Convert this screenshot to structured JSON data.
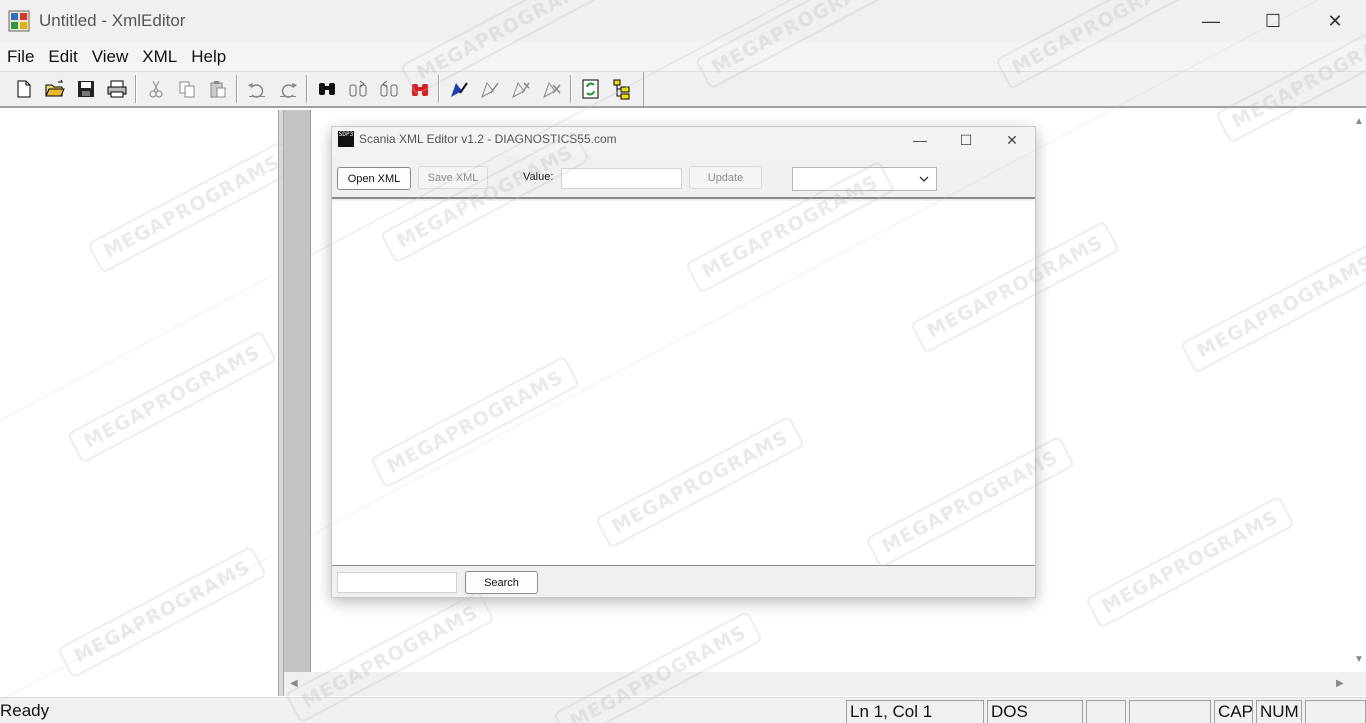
{
  "window": {
    "title": "Untitled - XmlEditor",
    "minimize_glyph": "—",
    "maximize_glyph": "☐",
    "close_glyph": "✕"
  },
  "menu": [
    "File",
    "Edit",
    "View",
    "XML",
    "Help"
  ],
  "toolbar": {
    "groups": [
      [
        "new-file-icon",
        "open-folder-icon",
        "save-icon",
        "print-icon"
      ],
      [
        "cut-icon",
        "copy-icon",
        "paste-icon"
      ],
      [
        "undo-icon",
        "redo-icon"
      ],
      [
        "find-icon",
        "find-next-icon",
        "find-prev-icon",
        "replace-icon"
      ],
      [
        "validate-icon",
        "pretty-print-icon",
        "xpath-icon",
        "xslt-icon"
      ],
      [
        "refresh-icon",
        "tree-view-icon"
      ]
    ]
  },
  "dialog": {
    "title": "Scania XML Editor v1.2 - DIAGNOSTICS55.com",
    "icon_text": "SDP3",
    "open_label": "Open XML",
    "save_label": "Save XML",
    "value_label": "Value:",
    "value_input": "",
    "update_label": "Update",
    "combo_value": "",
    "search_input": "",
    "search_label": "Search"
  },
  "status": {
    "ready": "Ready",
    "position": "Ln 1, Col 1",
    "format": "DOS",
    "cap": "CAP",
    "num": "NUM"
  },
  "watermark": "MEGAPROGRAMS",
  "colors": {
    "gutter": "#c4c4c4",
    "chrome": "#f0f0f0",
    "find_red": "#d82020",
    "validate_blue": "#1c3fb8"
  }
}
